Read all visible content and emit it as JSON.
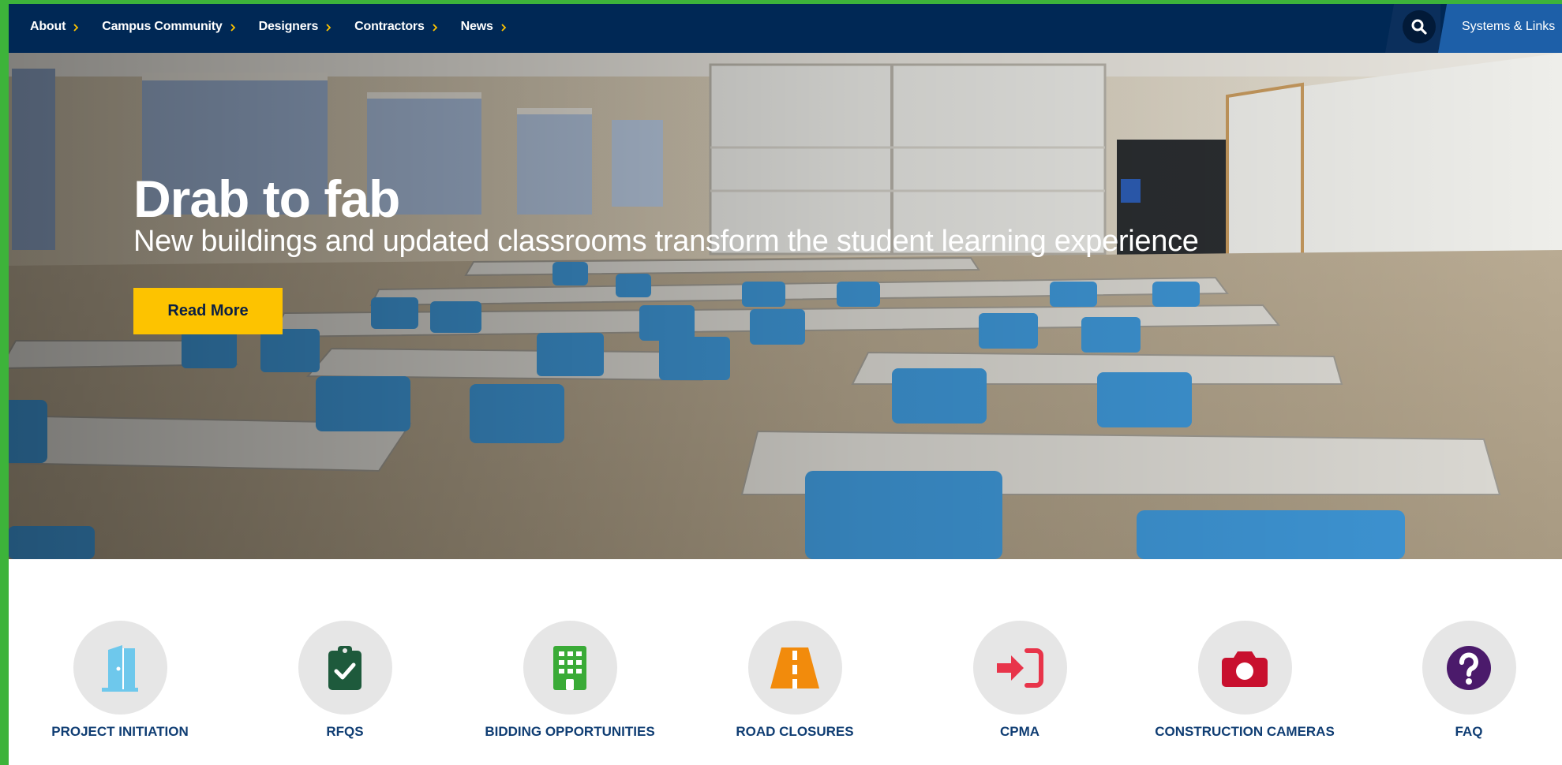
{
  "nav": {
    "items": [
      {
        "label": "About"
      },
      {
        "label": "Campus Community"
      },
      {
        "label": "Designers"
      },
      {
        "label": "Contractors"
      },
      {
        "label": "News"
      }
    ],
    "systems_label": "Systems & Links"
  },
  "hero": {
    "title": "Drab to fab",
    "subtitle": "New buildings and updated classrooms transform the student learning experience",
    "button_label": "Read More"
  },
  "quick_links": [
    {
      "label": "PROJECT INITIATION",
      "icon": "door-icon",
      "color": "#6ec8ec"
    },
    {
      "label": "RFQS",
      "icon": "clipboard-check-icon",
      "color": "#1e5a3c"
    },
    {
      "label": "BIDDING OPPORTUNITIES",
      "icon": "building-icon",
      "color": "#3aab37"
    },
    {
      "label": "ROAD CLOSURES",
      "icon": "road-icon",
      "color": "#f28b0c"
    },
    {
      "label": "CPMA",
      "icon": "sign-in-icon",
      "color": "#e8344a"
    },
    {
      "label": "CONSTRUCTION CAMERAS",
      "icon": "camera-icon",
      "color": "#c8102e"
    },
    {
      "label": "FAQ",
      "icon": "question-icon",
      "color": "#4b1a6b"
    }
  ],
  "colors": {
    "nav_bg": "#002855",
    "accent": "#fdc300",
    "link_text": "#0f3d73",
    "frame": "#3db33a"
  }
}
